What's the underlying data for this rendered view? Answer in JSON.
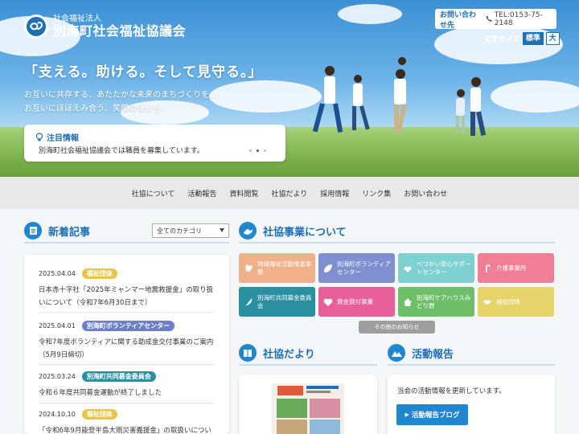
{
  "header": {
    "org_type": "社会福祉法人",
    "org_name": "別海町社会福祉協議会",
    "contact_label": "お問い合わせ先",
    "tel": "TEL:0153-75-2148",
    "font_size_label": "文字サイズ",
    "font_size_normal": "標準",
    "font_size_large": "大"
  },
  "hero": {
    "tagline": "「支える。助ける。そして見守る。」",
    "lead_line1": "お互いに共存する、あたたかな未来のまちづくりを。",
    "lead_line2": "お互いにほほえみ合う、笑顔の毎日を。",
    "notice_title": "注目情報",
    "notice_text": "別海町社会福祉協議会では職員を募集しています。"
  },
  "nav": {
    "items": [
      "社協について",
      "活動報告",
      "資料閲覧",
      "社協だより",
      "採用情報",
      "リンク集",
      "お問い合わせ"
    ]
  },
  "news": {
    "title": "新着記事",
    "category_select": "全てのカテゴリ",
    "items": [
      {
        "date": "2025.04.04",
        "badge": "福祉団体",
        "badge_color": "#e6c54a",
        "text": "日本赤十字社「2025年ミャンマー地震救援金」の取り扱いについて（令和7年6月30日まで）"
      },
      {
        "date": "2025.04.01",
        "badge": "別海町ボランティアセンター",
        "badge_color": "#6c7fc6",
        "text": "令和7年度ボランティアに関する助成金交付事業のご案内（5月9日締切）"
      },
      {
        "date": "2025.03.24",
        "badge": "別海町共同募金委員会",
        "badge_color": "#2a8fa0",
        "text": "令和６年度共同募金運動が終了しました"
      },
      {
        "date": "2024.10.10",
        "badge": "福祉団体",
        "badge_color": "#e6c54a",
        "text": "「令和6年9月能登半島大雨災害義援金」の取扱いについて"
      }
    ]
  },
  "services": {
    "title": "社協事業について",
    "tiles": [
      {
        "label": "地域福祉活動推進事業",
        "color": "#f0b089",
        "icon": "hokkaido-icon"
      },
      {
        "label": "別海町ボランティアセンター",
        "color": "#7f8fd0",
        "icon": "leaf-icon"
      },
      {
        "label": "べつかい安心サポートセンター",
        "color": "#7fd0d0",
        "icon": "handshake-icon"
      },
      {
        "label": "介護事業所",
        "color": "#f07f95",
        "icon": "cane-icon"
      },
      {
        "label": "別海町共同募金委員会",
        "color": "#2a8fa0",
        "icon": "feather-icon"
      },
      {
        "label": "資金貸付事業",
        "color": "#e8609a",
        "icon": "heart-icon"
      },
      {
        "label": "別海町ケアハウスみどり野",
        "color": "#6fbf6a",
        "icon": "house-icon"
      },
      {
        "label": "福祉団体",
        "color": "#e6d36a",
        "icon": "shake-hands-icon"
      }
    ],
    "more_label": "その他のお知らせ"
  },
  "newsletter": {
    "title": "社協だより"
  },
  "activity": {
    "title": "活動報告",
    "text": "当会の活動情報を更新しています。",
    "blog_button": "活動報告ブログ"
  }
}
